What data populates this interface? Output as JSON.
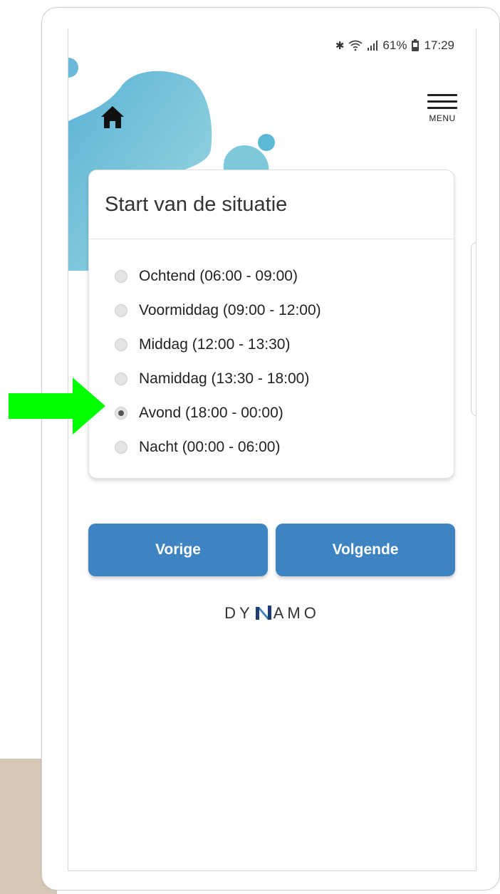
{
  "status_bar": {
    "icons": [
      "bluetooth-icon",
      "wifi-icon",
      "signal-icon",
      "battery-icon"
    ],
    "battery": "61%",
    "time": "17:29"
  },
  "header": {
    "home_icon": "home-icon",
    "menu_label": "MENU"
  },
  "card": {
    "title": "Start van de situatie",
    "options": [
      {
        "label": "Ochtend (06:00 - 09:00)",
        "checked": false
      },
      {
        "label": "Voormiddag (09:00 - 12:00)",
        "checked": false
      },
      {
        "label": "Middag (12:00 - 13:30)",
        "checked": false
      },
      {
        "label": "Namiddag (13:30 - 18:00)",
        "checked": false
      },
      {
        "label": "Avond (18:00 - 00:00)",
        "checked": true
      },
      {
        "label": "Nacht (00:00 - 06:00)",
        "checked": false
      }
    ]
  },
  "buttons": {
    "prev": "Vorige",
    "next": "Volgende"
  },
  "logo": {
    "left": "DY",
    "right": "AMO"
  },
  "colors": {
    "button": "#3f84c2",
    "arrow": "#00ff00",
    "blob": "#7ec8db"
  }
}
